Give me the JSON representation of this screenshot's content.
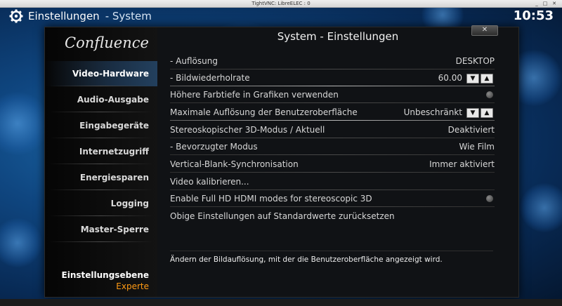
{
  "window": {
    "title": "TightVNC: LibreELEC : 0",
    "controls": [
      "_",
      "□",
      "✕"
    ]
  },
  "header": {
    "icon": "gear-icon",
    "title": "Einstellungen",
    "subtitle": "- System",
    "clock": "10:53"
  },
  "sidebar": {
    "logo": "Confluence",
    "items": [
      {
        "label": "Video-Hardware",
        "active": true
      },
      {
        "label": "Audio-Ausgabe",
        "active": false
      },
      {
        "label": "Eingabegeräte",
        "active": false
      },
      {
        "label": "Internetzugriff",
        "active": false
      },
      {
        "label": "Energiesparen",
        "active": false
      },
      {
        "label": "Logging",
        "active": false
      },
      {
        "label": "Master-Sperre",
        "active": false
      }
    ],
    "level_title": "Einstellungsebene",
    "level_value": "Experte"
  },
  "dialog": {
    "title": "System - Einstellungen",
    "close_label": "✕"
  },
  "settings": [
    {
      "name": "- Auflösung",
      "value": "DESKTOP"
    },
    {
      "name": "- Bildwiederholrate",
      "value": "60.00",
      "spinner": true
    },
    {
      "name": "Höhere Farbtiefe in Grafiken verwenden",
      "value": "",
      "toggle": "off"
    },
    {
      "name": "Maximale Auflösung der Benutzeroberfläche",
      "value": "Unbeschränkt",
      "spinner": true
    },
    {
      "name": "Stereoskopischer 3D-Modus / Aktuell",
      "value": "Deaktiviert"
    },
    {
      "name": "- Bevorzugter Modus",
      "value": "Wie Film"
    },
    {
      "name": "Vertical-Blank-Synchronisation",
      "value": "Immer aktiviert"
    },
    {
      "name": "Video kalibrieren...",
      "value": ""
    },
    {
      "name": "Enable Full HD HDMI modes for stereoscopic 3D",
      "value": "",
      "toggle": "off"
    },
    {
      "name": "Obige Einstellungen auf Standardwerte zurücksetzen",
      "value": ""
    }
  ],
  "spinner": {
    "down": "▼",
    "up": "▲"
  },
  "description": "Ändern der Bildauflösung, mit der die Benutzeroberfläche angezeigt wird.",
  "colors": {
    "accent": "#ff9a14",
    "background": "#0f4680"
  }
}
